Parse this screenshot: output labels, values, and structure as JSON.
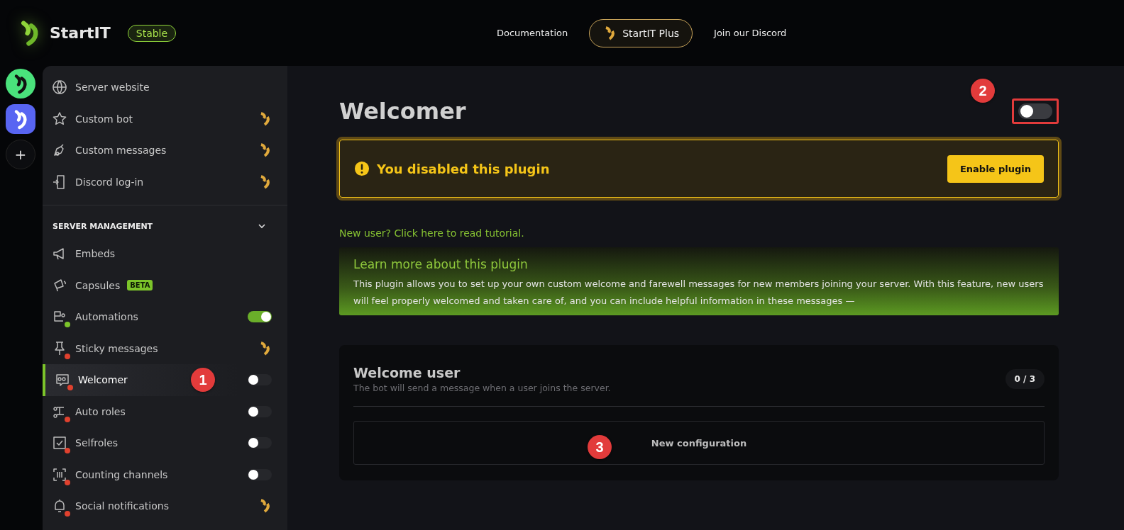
{
  "header": {
    "brand": "StartIT",
    "channel_badge": "Stable",
    "nav": [
      {
        "label": "Documentation",
        "kind": "link"
      },
      {
        "label": "StartIT Plus",
        "kind": "plus"
      },
      {
        "label": "Join our Discord",
        "kind": "link"
      }
    ]
  },
  "server_rail": [
    {
      "kind": "server",
      "color": "#4ae27c"
    },
    {
      "kind": "server",
      "color": "#5865f2"
    },
    {
      "kind": "add",
      "label": "+"
    }
  ],
  "sidebar": {
    "top_items": [
      {
        "label": "Server website",
        "kind": "plain"
      },
      {
        "label": "Custom bot",
        "kind": "premium"
      },
      {
        "label": "Custom messages",
        "kind": "premium"
      },
      {
        "label": "Discord log-in",
        "kind": "premium"
      }
    ],
    "section": {
      "title": "SERVER MANAGEMENT",
      "expanded": true,
      "items": [
        {
          "label": "Embeds",
          "kind": "plain",
          "selected": false
        },
        {
          "label": "Capsules",
          "badge": "BETA",
          "kind": "plain",
          "selected": false
        },
        {
          "label": "Automations",
          "kind": "toggle",
          "on": true,
          "color": "#7cc42a",
          "selected": false
        },
        {
          "label": "Sticky messages",
          "kind": "premium",
          "color": "#e0412e",
          "selected": false
        },
        {
          "label": "Welcomer",
          "kind": "toggle",
          "on": false,
          "color": "#e0412e",
          "selected": true,
          "annotation": "1"
        },
        {
          "label": "Auto roles",
          "kind": "toggle",
          "on": false,
          "color": "#e0412e",
          "selected": false
        },
        {
          "label": "Selfroles",
          "kind": "toggle",
          "on": false,
          "color": "#e0412e",
          "selected": false
        },
        {
          "label": "Counting channels",
          "kind": "toggle",
          "on": false,
          "color": "#e0412e",
          "selected": false
        },
        {
          "label": "Social notifications",
          "kind": "premium",
          "color": "#e0412e",
          "selected": false
        }
      ]
    }
  },
  "main": {
    "title": "Welcomer",
    "plugin_enabled": false,
    "toggle_annotation": "2",
    "alert": {
      "message": "You disabled this plugin",
      "button": "Enable plugin"
    },
    "tutorial_link": "New user? Click here to read tutorial.",
    "info": {
      "title": "Learn more about this plugin",
      "text": "This plugin allows you to set up your own custom welcome and farewell messages for new members joining your server. With this feature, new users will feel properly welcomed and taken care of, and you can include helpful information in these messages —"
    },
    "card": {
      "title": "Welcome user",
      "subtitle": "The bot will send a message when a user joins the server.",
      "count": "0 / 3",
      "button": "New configuration",
      "button_annotation": "3"
    }
  }
}
